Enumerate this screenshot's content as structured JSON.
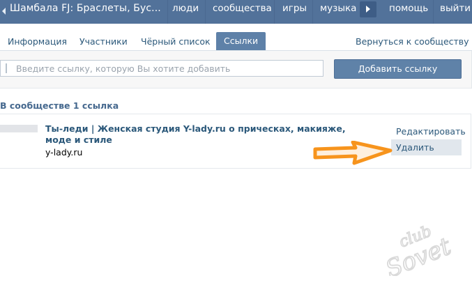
{
  "topbar": {
    "title": "Шамбала FJ: Браслеты, Бус...",
    "nav": [
      "люди",
      "сообщества",
      "игры",
      "музыка",
      "помощь",
      "выйти"
    ]
  },
  "tabs": {
    "items": [
      "Информация",
      "Участники",
      "Чёрный список",
      "Ссылки"
    ],
    "active": "Ссылки",
    "back": "Вернуться к сообществу"
  },
  "add_link": {
    "placeholder": "Введите ссылку, которую Вы хотите добавить",
    "button": "Добавить ссылку"
  },
  "summary": "В сообществе 1 ссылка",
  "links": [
    {
      "title": "Ты-леди | Женская студия Y-lady.ru о прическах, макияже, моде и стиле",
      "url": "y-lady.ru",
      "edit": "Редактировать",
      "delete": "Удалить"
    }
  ],
  "annotation": {
    "color": "#f7941d"
  },
  "watermark": {
    "text_top": "club",
    "text_bottom": "Sovet",
    "color": "#d9d9d9"
  }
}
